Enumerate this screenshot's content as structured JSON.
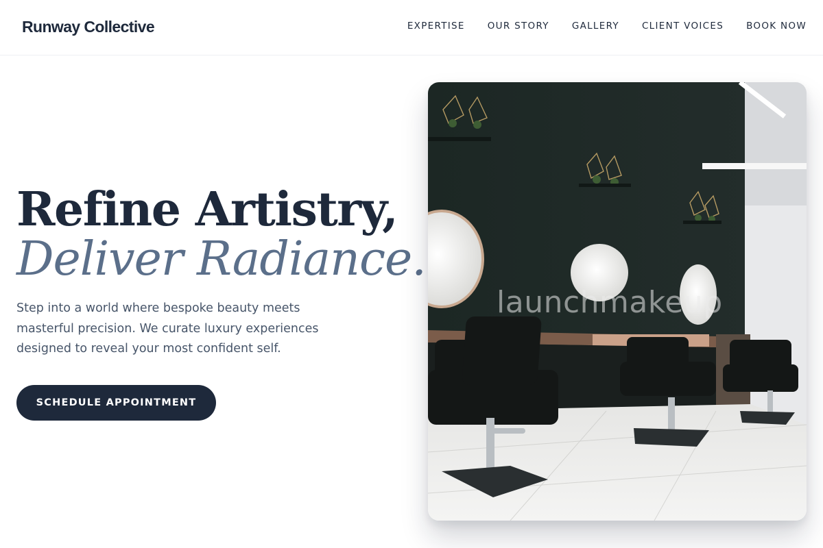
{
  "header": {
    "brand": "Runway Collective",
    "nav": [
      {
        "label": "EXPERTISE"
      },
      {
        "label": "OUR STORY"
      },
      {
        "label": "GALLERY"
      },
      {
        "label": "CLIENT VOICES"
      },
      {
        "label": "BOOK NOW"
      }
    ]
  },
  "hero": {
    "title_line1": "Refine Artistry,",
    "title_line2": "Deliver Radiance.",
    "subtitle": "Step into a world where bespoke beauty meets masterful precision. We curate luxury experiences designed to reveal your most confident self.",
    "cta_label": "SCHEDULE APPOINTMENT"
  },
  "photo": {
    "watermark": "launchmakeup"
  },
  "colors": {
    "primary": "#1e293b",
    "accent_italic": "#5b6f8a",
    "body_text": "#475569"
  }
}
